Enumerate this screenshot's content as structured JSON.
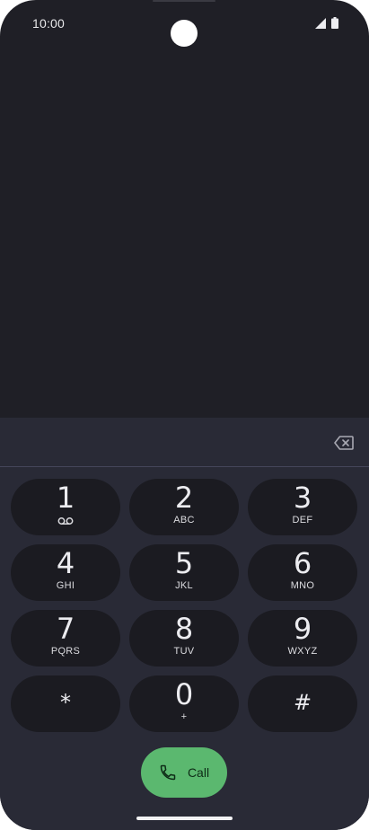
{
  "status": {
    "time": "10:00",
    "signal_icon": "cellular-signal-icon",
    "battery_icon": "battery-icon"
  },
  "number_field": {
    "value": "",
    "backspace_icon": "backspace-icon"
  },
  "keypad": {
    "keys": [
      {
        "digit": "1",
        "letters": "",
        "icon": "voicemail-icon"
      },
      {
        "digit": "2",
        "letters": "ABC"
      },
      {
        "digit": "3",
        "letters": "DEF"
      },
      {
        "digit": "4",
        "letters": "GHI"
      },
      {
        "digit": "5",
        "letters": "JKL"
      },
      {
        "digit": "6",
        "letters": "MNO"
      },
      {
        "digit": "7",
        "letters": "PQRS"
      },
      {
        "digit": "8",
        "letters": "TUV"
      },
      {
        "digit": "9",
        "letters": "WXYZ"
      },
      {
        "digit": "*",
        "letters": ""
      },
      {
        "digit": "0",
        "letters": "+"
      },
      {
        "digit": "#",
        "letters": ""
      }
    ]
  },
  "call_button": {
    "label": "Call",
    "icon": "phone-icon"
  },
  "colors": {
    "background": "#1f1f26",
    "dialer_background": "#292a36",
    "key_background": "#1b1b21",
    "call_green": "#5bb86f"
  }
}
